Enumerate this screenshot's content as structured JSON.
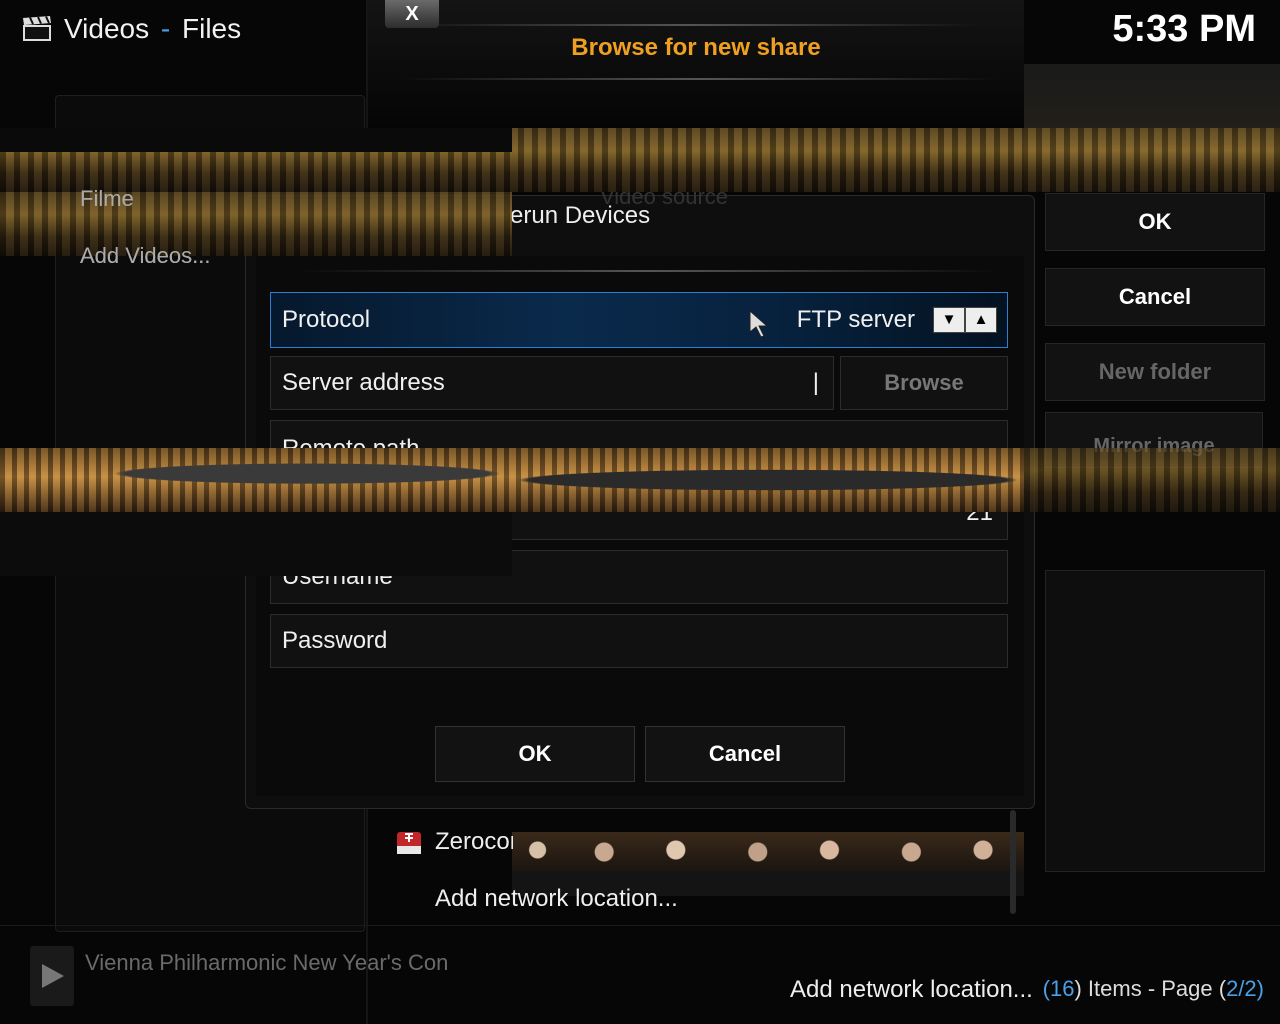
{
  "header": {
    "section": "Videos",
    "separator": "-",
    "subsection": "Files"
  },
  "clock": "5:33 PM",
  "left_menu": {
    "items": [
      "Filme",
      "Add Videos..."
    ]
  },
  "browse_dialog": {
    "close_label": "X",
    "title": "Browse for new share"
  },
  "video_source_dialog": {
    "title_partial": "Video source",
    "source_partial": "erun Devices",
    "sources": [
      {
        "label": "Zeroconf",
        "icon": "zeroconf-icon"
      },
      {
        "label": "Add network location..."
      }
    ]
  },
  "share_dialog": {
    "protocol_label": "Protocol",
    "protocol_value": "FTP server",
    "server_address_label": "Server address",
    "server_address_value": "|",
    "browse_label": "Browse",
    "remote_path_label": "Remote path",
    "port_value": "21",
    "username_label": "Username",
    "password_label": "Password",
    "ok_label": "OK",
    "cancel_label": "Cancel"
  },
  "side_buttons": {
    "ok": "OK",
    "cancel": "Cancel",
    "new_folder": "New folder",
    "mirror_image": "Mirror image"
  },
  "bottom": {
    "now_playing": "Vienna Philharmonic New Year's Con",
    "add_network_location": "Add network location...",
    "items_prefix": "(",
    "items_count": "16",
    "items_mid": ") Items - Page (",
    "page": "2/2",
    "items_suffix": ")"
  },
  "colors": {
    "accent_orange": "#f0a020",
    "focus_blue": "#2f7fd0",
    "count_blue": "#4aa0e8"
  }
}
